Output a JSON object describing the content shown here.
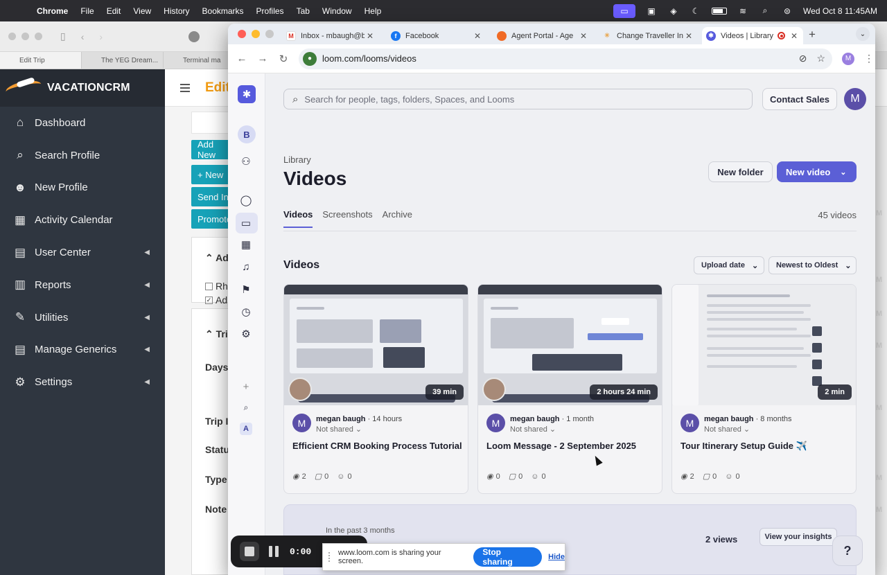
{
  "menubar": {
    "items": [
      "Chrome",
      "File",
      "Edit",
      "View",
      "History",
      "Bookmarks",
      "Profiles",
      "Tab",
      "Window",
      "Help"
    ],
    "clock": "Wed Oct 8  11:45AM"
  },
  "bg_window": {
    "tabs": [
      "Edit Trip",
      "The YEG Dream...",
      "Terminal ma"
    ],
    "logo": "VACATIONCRM",
    "nav": [
      {
        "label": "Dashboard",
        "icon": "home-icon"
      },
      {
        "label": "Search Profile",
        "icon": "search-icon"
      },
      {
        "label": "New Profile",
        "icon": "user-plus-icon"
      },
      {
        "label": "Activity Calendar",
        "icon": "calendar-icon"
      },
      {
        "label": "User Center",
        "icon": "id-card-icon"
      },
      {
        "label": "Reports",
        "icon": "reports-icon"
      },
      {
        "label": "Utilities",
        "icon": "wrench-icon"
      },
      {
        "label": "Manage Generics",
        "icon": "list-icon"
      },
      {
        "label": "Settings",
        "icon": "gear-icon"
      }
    ],
    "header_title": "Edit",
    "buttons": [
      "Add New",
      "+ New",
      "Send In",
      "Promote"
    ],
    "panel1_title": "Ad",
    "checks": [
      "Rh",
      "Ad"
    ],
    "panel2_title": "Tri",
    "fields": [
      "Days",
      "Trip I",
      "Statu",
      "Type",
      "Note"
    ]
  },
  "chrome": {
    "tabs": [
      {
        "title": "Inbox - mbaugh@b",
        "favicon": "gmail-icon"
      },
      {
        "title": "Facebook",
        "favicon": "facebook-icon"
      },
      {
        "title": "Agent Portal - Age",
        "favicon": "agent-portal-icon"
      },
      {
        "title": "Change Traveller In",
        "favicon": "loading-icon"
      },
      {
        "title": "Videos | Library",
        "favicon": "loom-icon",
        "active": true
      }
    ],
    "url": "loom.com/looms/videos",
    "profile_initial": "M"
  },
  "loom": {
    "search_placeholder": "Search for people, tags, folders, Spaces, and Looms",
    "contact_sales": "Contact Sales",
    "avatar_initial": "M",
    "workspace_initial": "B",
    "workspace2_initial": "A",
    "breadcrumb": "Library",
    "title": "Videos",
    "new_folder": "New folder",
    "new_video": "New video",
    "tabs": [
      "Videos",
      "Screenshots",
      "Archive"
    ],
    "video_count": "45 videos",
    "section": "Videos",
    "sort_field": "Upload date",
    "sort_order": "Newest to Oldest",
    "videos": [
      {
        "author": "megan baugh",
        "age": "· 14 hours",
        "shared": "Not shared",
        "title": "Efficient CRM Booking Process Tutorial",
        "duration": "39 min",
        "views": "2",
        "comments": "0",
        "reactions": "0"
      },
      {
        "author": "megan baugh",
        "age": "· 1 month",
        "shared": "Not shared",
        "title": "Loom Message - 2 September 2025",
        "duration": "2 hours 24 min",
        "views": "0",
        "comments": "0",
        "reactions": "0"
      },
      {
        "author": "megan baugh",
        "age": "· 8 months",
        "shared": "Not shared",
        "title": "Tour Itinerary Setup Guide ✈️",
        "duration": "2 min",
        "views": "2",
        "comments": "0",
        "reactions": "0"
      }
    ],
    "insights": {
      "period": "In the past 3 months",
      "views": "2 views",
      "button": "View your insights"
    },
    "help": "?"
  },
  "recorder": {
    "time": "0:00"
  },
  "sharebar": {
    "message": "www.loom.com is sharing your screen.",
    "stop": "Stop sharing",
    "hide": "Hide"
  },
  "colors": {
    "loom_primary": "#5b5fd6",
    "crm_accent": "#f39c12",
    "crm_sidebar": "#2f3640",
    "crm_button": "#17a2b8"
  }
}
